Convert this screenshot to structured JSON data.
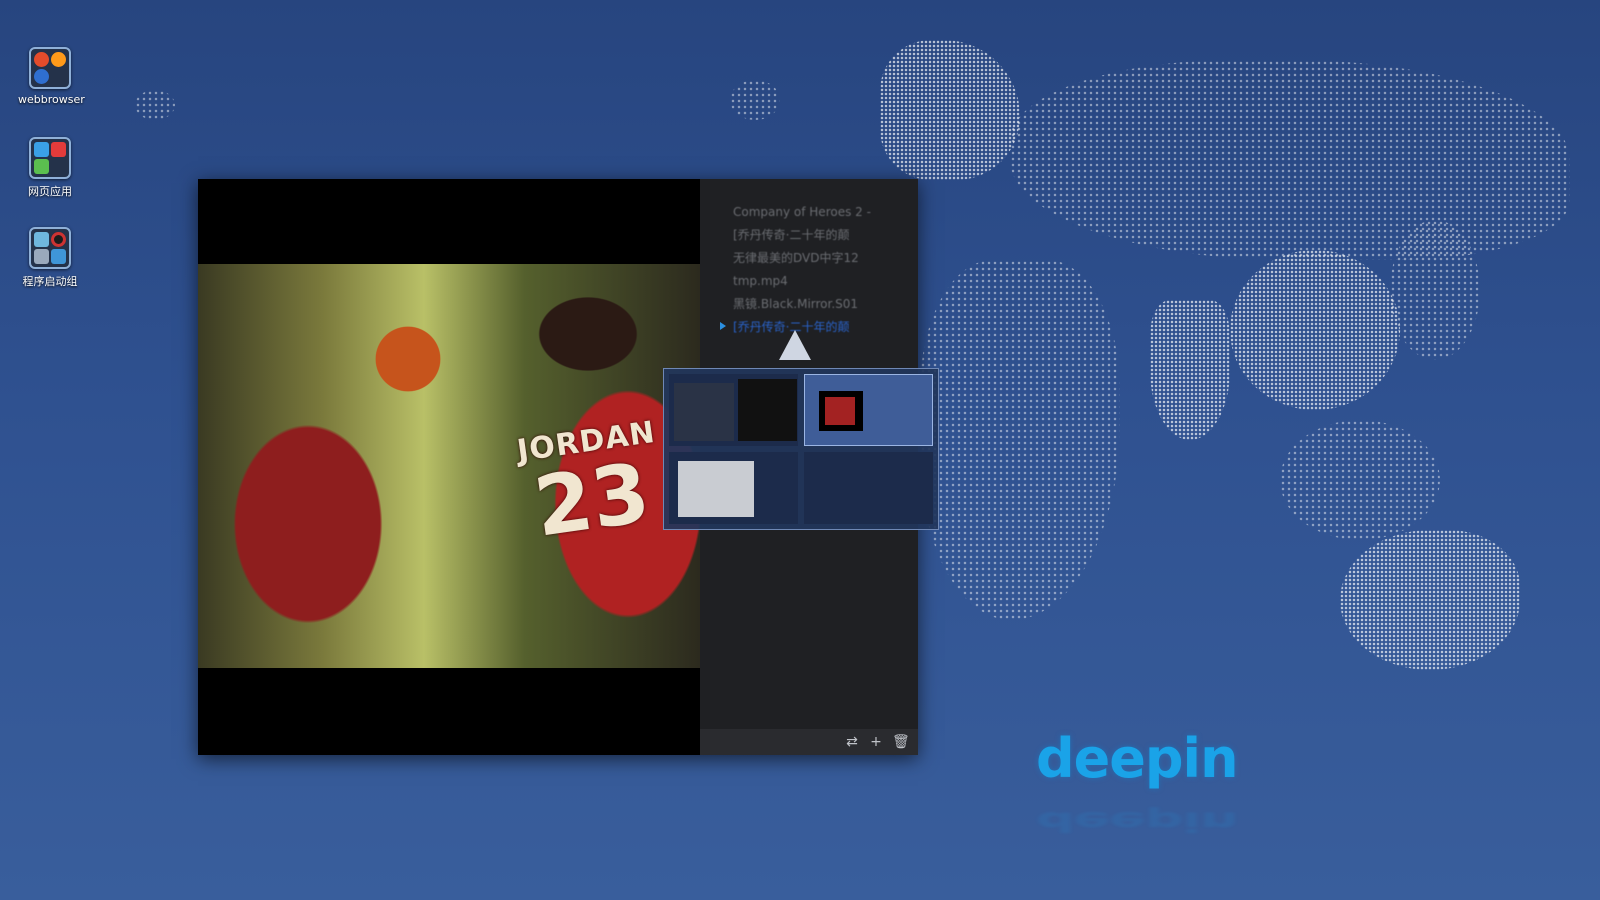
{
  "desktop": {
    "icons": [
      {
        "label": "webbrowser"
      },
      {
        "label": "网页应用"
      },
      {
        "label": "程序启动组"
      }
    ]
  },
  "player": {
    "video": {
      "jersey_name": "JORDAN",
      "jersey_number": "23"
    },
    "playlist": {
      "items": [
        {
          "label": "Company of Heroes 2 -"
        },
        {
          "label": "[乔丹传奇·二十年的颠"
        },
        {
          "label": "无律最美的DVD中字12"
        },
        {
          "label": "tmp.mp4"
        },
        {
          "label": "黑镜.Black.Mirror.S01"
        },
        {
          "label": "[乔丹传奇·二十年的颠",
          "active": true
        }
      ],
      "toolbar": {
        "repeat_icon": "⇄",
        "add_icon": "+",
        "delete_icon": "🗑"
      }
    }
  },
  "workspace_switcher": {
    "selected_index": 1,
    "workspaces": [
      {
        "name": "workspace-1"
      },
      {
        "name": "workspace-2"
      },
      {
        "name": "workspace-3"
      },
      {
        "name": "workspace-4"
      }
    ]
  },
  "brand": {
    "logo_text": "deepin",
    "color": "#1aa3e8"
  }
}
